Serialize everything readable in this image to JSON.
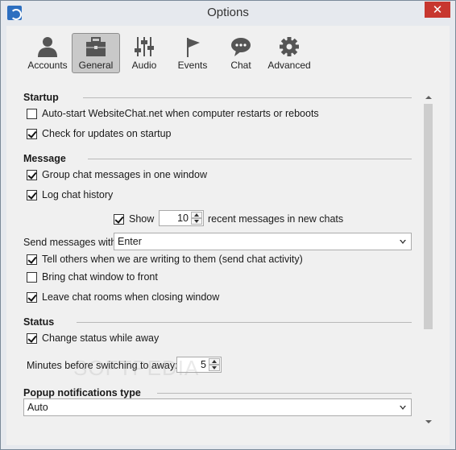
{
  "window": {
    "title": "Options",
    "close_label": "✕"
  },
  "toolbar": {
    "items": [
      {
        "label": "Accounts",
        "icon": "person-icon"
      },
      {
        "label": "General",
        "icon": "briefcase-icon",
        "active": true
      },
      {
        "label": "Audio",
        "icon": "equalizer-icon"
      },
      {
        "label": "Events",
        "icon": "flag-icon"
      },
      {
        "label": "Chat",
        "icon": "chat-bubble-icon"
      },
      {
        "label": "Advanced",
        "icon": "gear-icon"
      }
    ]
  },
  "startup": {
    "title": "Startup",
    "auto_start": {
      "label": "Auto-start WebsiteChat.net when computer restarts or reboots",
      "checked": false
    },
    "check_updates": {
      "label": "Check for updates on startup",
      "checked": true
    }
  },
  "message": {
    "title": "Message",
    "group_chat": {
      "label": "Group chat messages in one window",
      "checked": true
    },
    "log_history": {
      "label": "Log chat history",
      "checked": true
    },
    "show": {
      "label": "Show",
      "checked": true,
      "value": "10",
      "suffix": "recent messages in new chats"
    },
    "send_with": {
      "label": "Send messages with:",
      "value": "Enter"
    },
    "tell_others": {
      "label": "Tell others when we are writing to them (send chat activity)",
      "checked": true
    },
    "bring_front": {
      "label": "Bring chat window to front",
      "checked": false
    },
    "leave_rooms": {
      "label": "Leave chat rooms when closing window",
      "checked": true
    }
  },
  "status": {
    "title": "Status",
    "change_away": {
      "label": "Change status while away",
      "checked": true
    },
    "minutes": {
      "label": "Minutes before switching to away:",
      "value": "5"
    }
  },
  "popup": {
    "title": "Popup notifications type",
    "value": "Auto"
  },
  "watermark": "SOFTPEDIA"
}
